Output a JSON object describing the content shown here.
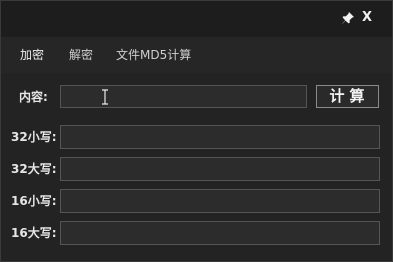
{
  "titlebar": {
    "pin_icon": "pin-icon",
    "close_label": "X"
  },
  "tabs": [
    {
      "label": "加密",
      "active": true
    },
    {
      "label": "解密",
      "active": false
    },
    {
      "label": "文件MD5计算",
      "active": false
    }
  ],
  "form": {
    "content_label": "内容:",
    "content_value": "",
    "calc_button": "计算",
    "outputs": [
      {
        "label": "32小写:",
        "value": ""
      },
      {
        "label": "32大写:",
        "value": ""
      },
      {
        "label": "16小写:",
        "value": ""
      },
      {
        "label": "16大写:",
        "value": ""
      }
    ]
  },
  "colors": {
    "background": "#232323",
    "titlebar": "#1d1d1d",
    "field_border": "#555555",
    "text": "#e6e6e6"
  }
}
